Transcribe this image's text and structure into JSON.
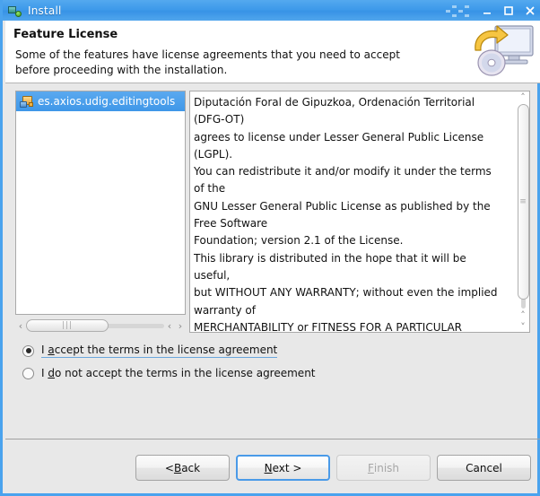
{
  "window": {
    "title": "Install",
    "icon": "install-app-icon",
    "controls": {
      "minimize": "minimize-button",
      "maximize": "maximize-button",
      "close": "close-button"
    },
    "accent_color": "#4aa3ee",
    "background_color": "#e8e8e8"
  },
  "header": {
    "title": "Feature License",
    "description": "Some of the features have license agreements that you need to accept\nbefore proceeding with the installation.",
    "icon": "install-monitor-disc-icon"
  },
  "feature_list": {
    "items": [
      {
        "label": "es.axios.udig.editingtools",
        "icon": "feature-plugin-icon",
        "selected": true
      }
    ],
    "hscrollbar": {
      "left_arrow": "‹",
      "right_arrow": "›",
      "grip": "|||"
    }
  },
  "license": {
    "text": "Diputación Foral de Gipuzkoa, Ordenación Territorial\n(DFG-OT)\nagrees to license under Lesser General Public License\n(LGPL).\nYou can redistribute it and/or modify it under the terms\nof the\nGNU Lesser General Public License as published by the\nFree Software\nFoundation; version 2.1 of the License.\nThis library is distributed in the hope that it will be\nuseful,\nbut WITHOUT ANY WARRANTY; without even the implied\nwarranty of\nMERCHANTABILITY or FITNESS FOR A PARTICULAR\nPURPOSE.  See the\nGNU",
    "vscrollbar": {
      "up_arrow": "˄",
      "down_arrow": "˅",
      "grip": "≡"
    }
  },
  "radios": {
    "accept": {
      "label_pre": "I ",
      "label_mnemonic": "a",
      "label_post": "ccept the terms in the license agreement",
      "selected": true,
      "focused": true
    },
    "decline": {
      "label_pre": "I ",
      "label_mnemonic": "d",
      "label_post": "o not accept the terms in the license agreement",
      "selected": false,
      "focused": false
    }
  },
  "buttons": [
    {
      "name": "back-button",
      "pre": "< ",
      "mnemonic": "B",
      "post": "ack",
      "state": "enabled"
    },
    {
      "name": "next-button",
      "pre": "",
      "mnemonic": "N",
      "post": "ext >",
      "state": "focused"
    },
    {
      "name": "finish-button",
      "pre": "",
      "mnemonic": "F",
      "post": "inish",
      "state": "disabled"
    },
    {
      "name": "cancel-button",
      "pre": "",
      "mnemonic": "",
      "post": "Cancel",
      "state": "enabled"
    }
  ]
}
